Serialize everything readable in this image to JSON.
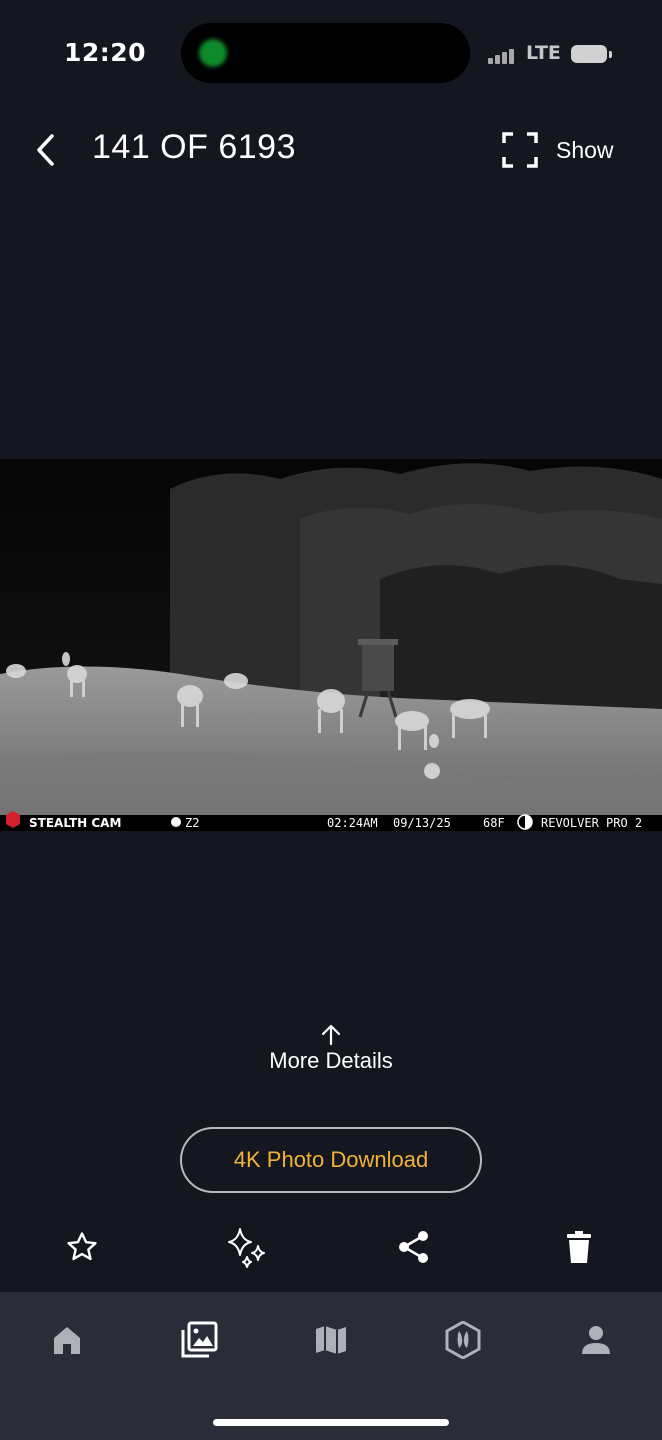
{
  "status_bar": {
    "time": "12:20",
    "network": "LTE",
    "icons": [
      "cellular-signal-icon",
      "battery-icon"
    ]
  },
  "header": {
    "title": "141 OF 6193",
    "back_icon": "chevron-left-icon",
    "show_label": "Show",
    "show_icon": "fullscreen-corners-icon"
  },
  "photo": {
    "stamp": {
      "brand": "STEALTH CAM",
      "camera_id": "Z2",
      "time": "02:24AM",
      "date": "09/13/25",
      "temperature": "68F",
      "model": "REVOLVER PRO 2"
    }
  },
  "more_details": {
    "label": "More Details",
    "icon": "arrow-up-icon"
  },
  "download": {
    "label": "4K Photo Download",
    "color": "#f2b233"
  },
  "actions": [
    {
      "name": "favorite",
      "icon": "star-outline-icon"
    },
    {
      "name": "enhance",
      "icon": "sparkles-icon"
    },
    {
      "name": "share",
      "icon": "share-icon"
    },
    {
      "name": "delete",
      "icon": "trash-icon"
    }
  ],
  "tabbar": {
    "tabs": [
      {
        "name": "home",
        "icon": "home-icon",
        "active": false
      },
      {
        "name": "photos",
        "icon": "photo-gallery-icon",
        "active": true
      },
      {
        "name": "map",
        "icon": "map-icon",
        "active": false
      },
      {
        "name": "hunt",
        "icon": "deer-track-badge-icon",
        "active": false
      },
      {
        "name": "account",
        "icon": "user-icon",
        "active": false
      }
    ]
  },
  "colors": {
    "background": "#141620",
    "tabbar": "#2a2c37",
    "accent": "#f2b233",
    "tab_inactive": "#aeb0b7",
    "tab_active": "#ffffff"
  }
}
